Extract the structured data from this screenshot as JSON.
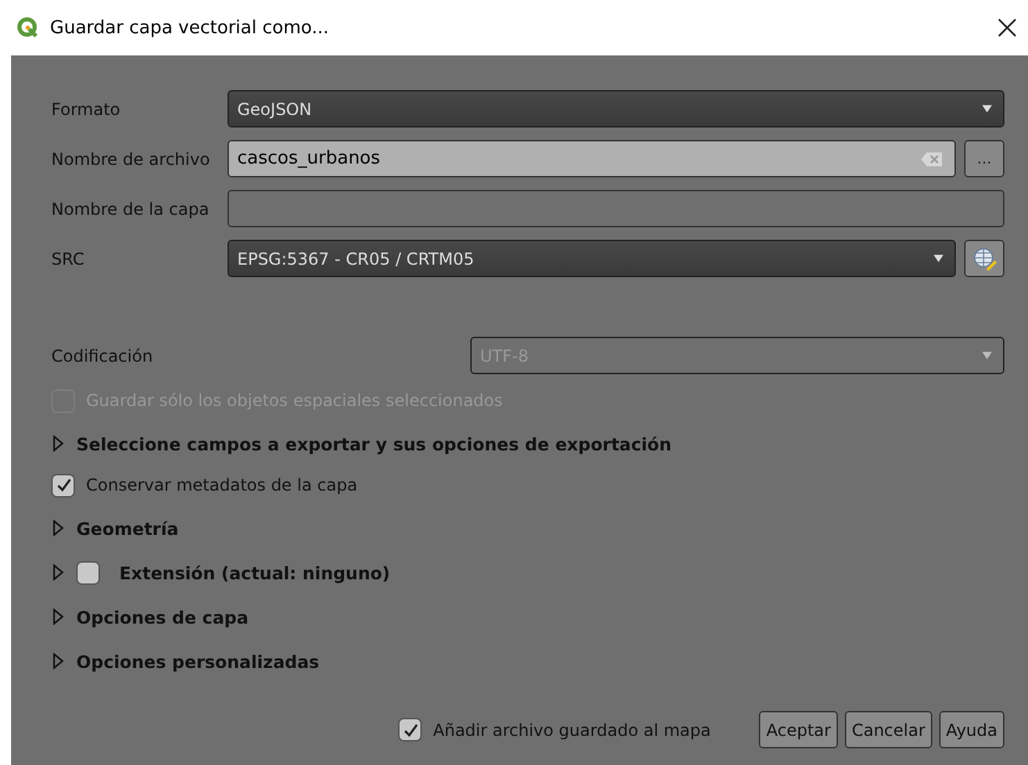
{
  "window": {
    "title": "Guardar capa vectorial como..."
  },
  "fields": [
    {
      "kind": "combo",
      "label": "Formato",
      "value": "GeoJSON"
    },
    {
      "kind": "file",
      "label": "Nombre de archivo",
      "value": "cascos_urbanos",
      "button": "..."
    },
    {
      "kind": "text",
      "label": "Nombre de la capa"
    },
    {
      "kind": "crs",
      "label": "SRC",
      "value": "EPSG:5367 - CR05 / CRTM05"
    }
  ],
  "encoding": {
    "label": "Codificación",
    "value": "UTF-8",
    "disabled": true
  },
  "options": [
    {
      "kind": "checkbox",
      "label": "Guardar sólo los objetos espaciales seleccionados",
      "checked": false,
      "disabled": true
    },
    {
      "kind": "section",
      "label": "Seleccione campos a exportar y sus opciones de exportación",
      "expanded": false
    },
    {
      "kind": "checkbox",
      "label": "Conservar metadatos de la capa",
      "checked": true,
      "disabled": false
    },
    {
      "kind": "section",
      "label": "Geometría",
      "expanded": false
    },
    {
      "kind": "checksection",
      "label": "Extensión (actual: ninguno)",
      "expanded": false,
      "checked": false
    },
    {
      "kind": "section",
      "label": "Opciones de capa",
      "expanded": false
    },
    {
      "kind": "section",
      "label": "Opciones personalizadas",
      "expanded": false
    }
  ],
  "footer": {
    "add_to_map": {
      "label": "Añadir archivo guardado al mapa",
      "checked": true
    },
    "buttons": [
      "Aceptar",
      "Cancelar",
      "Ayuda"
    ]
  }
}
